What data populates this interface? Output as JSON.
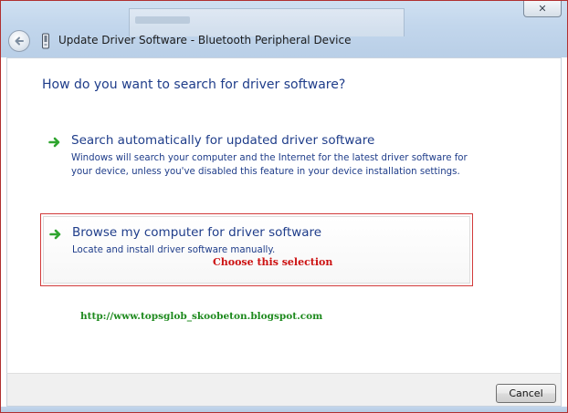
{
  "window": {
    "title": "Update Driver Software - Bluetooth Peripheral Device",
    "close_glyph": "✕"
  },
  "main": {
    "heading": "How do you want to search for driver software?",
    "options": [
      {
        "title": "Search automatically for updated driver software",
        "description": "Windows will search your computer and the Internet for the latest driver software for your device, unless you've disabled this feature in your device installation settings."
      },
      {
        "title": "Browse my computer for driver software",
        "description": "Locate and install driver software manually.",
        "annotation": "Choose this selection"
      }
    ],
    "watermark_url": "http://www.topsglob_skoobeton.blogspot.com"
  },
  "footer": {
    "cancel_label": "Cancel"
  },
  "icons": {
    "back": "back-arrow-icon",
    "device": "bluetooth-device-icon",
    "option_arrow": "green-arrow-icon",
    "close": "close-icon"
  },
  "colors": {
    "link_blue": "#1f3d8a",
    "annotation_red": "#cc1111",
    "watermark_green": "#1e8a1e",
    "arrow_green": "#2fa52f",
    "frame_glass": "#c2d6ec"
  }
}
